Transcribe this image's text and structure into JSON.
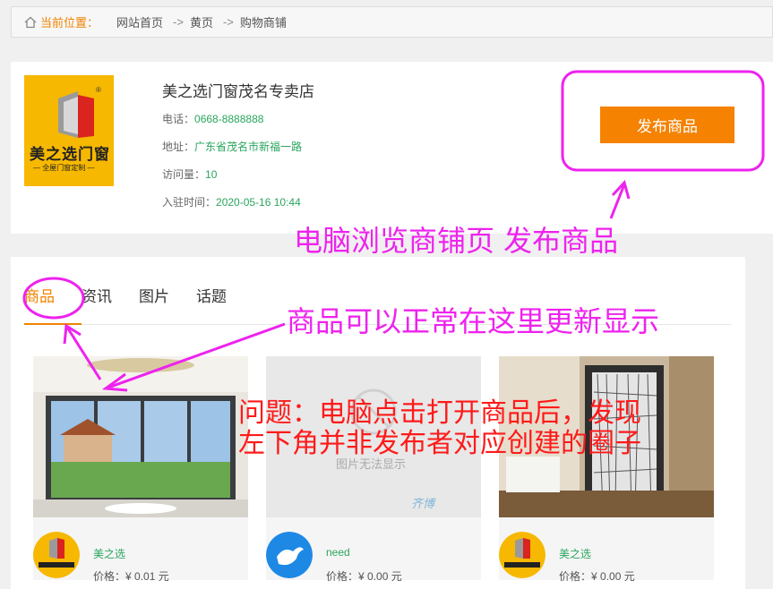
{
  "breadcrumb": {
    "label": "当前位置：",
    "items": [
      "网站首页",
      "黄页",
      "购物商铺"
    ],
    "separator": "->"
  },
  "shop": {
    "name": "美之选门窗茂名专卖店",
    "logo_text": "美之选门窗",
    "logo_sub": "— 全屋门窗定制 —",
    "phone_label": "电话：",
    "phone": "0668-8888888",
    "address_label": "地址：",
    "address": "广东省茂名市新福一路",
    "visits_label": "访问量：",
    "visits": "10",
    "joined_label": "入驻时间：",
    "joined": "2020-05-16 10:44",
    "publish_button": "发布商品"
  },
  "tabs": [
    "商品",
    "资讯",
    "图片",
    "话题"
  ],
  "products": [
    {
      "seller": "美之选",
      "price_label": "价格：",
      "price": "¥ 0.01 元"
    },
    {
      "seller": "need",
      "price_label": "价格：",
      "price": "¥ 0.00 元",
      "image_placeholder": "图片无法显示",
      "watermark": "齐博"
    },
    {
      "seller": "美之选",
      "price_label": "价格：",
      "price": "¥ 0.00 元"
    }
  ],
  "annotations": {
    "top": "电脑浏览商铺页  发布商品",
    "middle": "商品可以正常在这里更新显示",
    "problem_line1": "问题：电脑点击打开商品后，发现",
    "problem_line2": "左下角并非发布者对应创建的圈子"
  },
  "colors": {
    "accent": "#f08300",
    "button": "#f58200",
    "link_green": "#2aa55e",
    "annotation_magenta": "#ee22ee",
    "annotation_red": "#ff1a1a"
  }
}
